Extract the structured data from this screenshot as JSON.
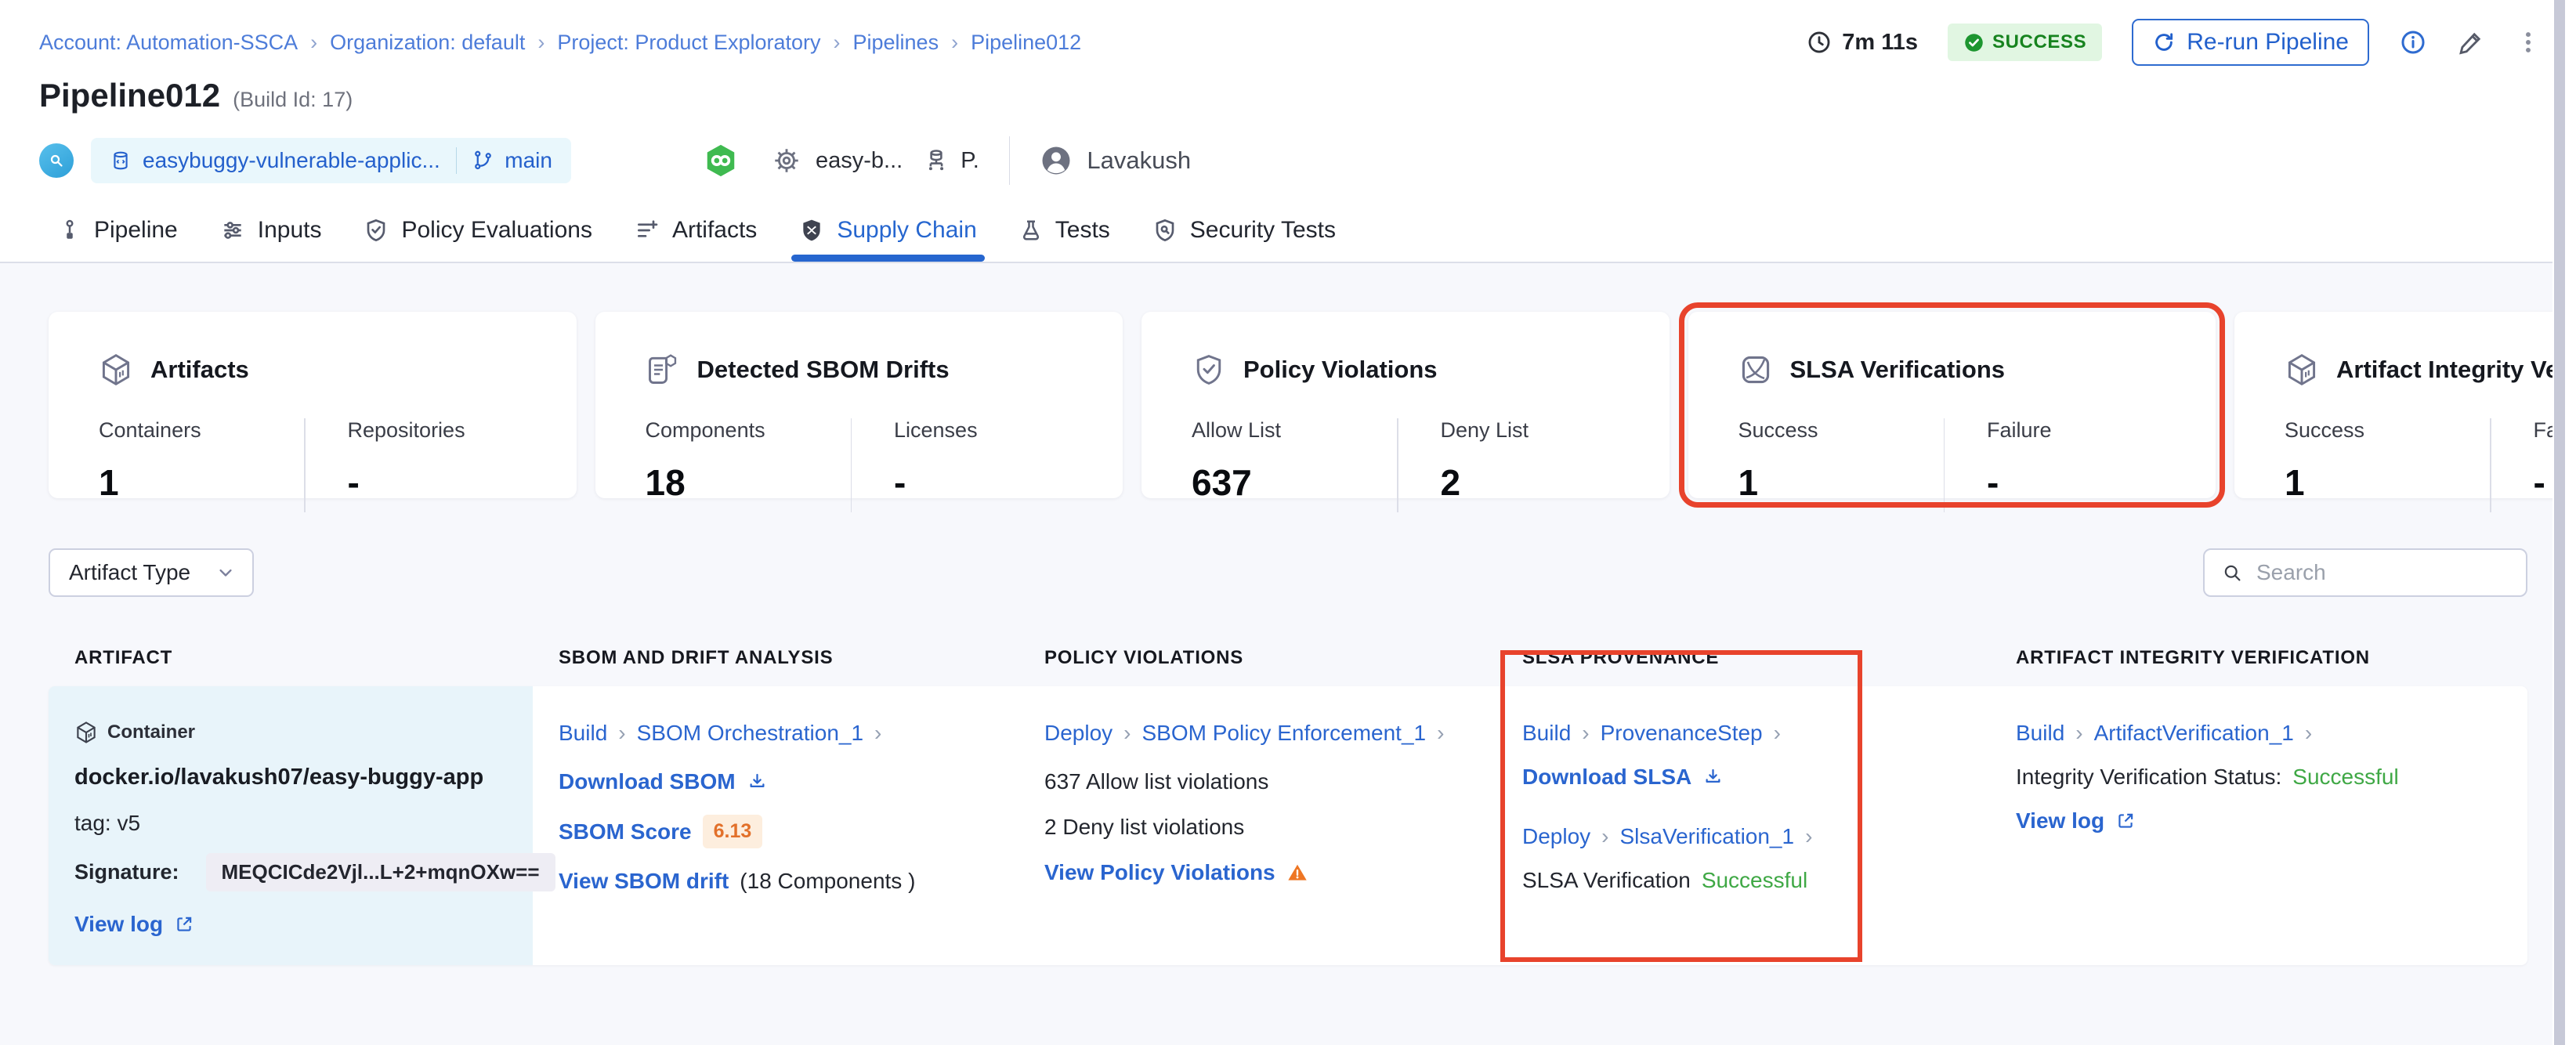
{
  "breadcrumb": [
    "Account: Automation-SSCA",
    "Organization: default",
    "Project: Product Exploratory",
    "Pipelines",
    "Pipeline012"
  ],
  "topbar": {
    "duration": "7m 11s",
    "status_badge": "SUCCESS",
    "rerun_button": "Re-run Pipeline"
  },
  "pipeline": {
    "title": "Pipeline012",
    "build_id": "(Build Id: 17)",
    "repo_name": "easybuggy-vulnerable-applic...",
    "branch": "main",
    "linked_pipeline": "easy-b...",
    "trigger_initial": "P.",
    "user_name": "Lavakush"
  },
  "tabs": [
    {
      "label": "Pipeline"
    },
    {
      "label": "Inputs"
    },
    {
      "label": "Policy Evaluations"
    },
    {
      "label": "Artifacts"
    },
    {
      "label": "Supply Chain",
      "active": true
    },
    {
      "label": "Tests"
    },
    {
      "label": "Security Tests"
    }
  ],
  "cards": [
    {
      "title": "Artifacts",
      "stats": [
        {
          "label": "Containers",
          "value": "1"
        },
        {
          "label": "Repositories",
          "value": "-"
        }
      ]
    },
    {
      "title": "Detected SBOM Drifts",
      "stats": [
        {
          "label": "Components",
          "value": "18"
        },
        {
          "label": "Licenses",
          "value": "-"
        }
      ]
    },
    {
      "title": "Policy Violations",
      "stats": [
        {
          "label": "Allow List",
          "value": "637"
        },
        {
          "label": "Deny List",
          "value": "2"
        }
      ]
    },
    {
      "title": "SLSA Verifications",
      "highlighted": true,
      "stats": [
        {
          "label": "Success",
          "value": "1"
        },
        {
          "label": "Failure",
          "value": "-"
        }
      ]
    },
    {
      "title": "Artifact Integrity Verification",
      "stats": [
        {
          "label": "Success",
          "value": "1"
        },
        {
          "label": "Failure",
          "value": "-"
        }
      ]
    }
  ],
  "filters": {
    "artifact_type": "Artifact Type",
    "search_placeholder": "Search"
  },
  "table": {
    "headers": [
      "ARTIFACT",
      "SBOM AND DRIFT ANALYSIS",
      "POLICY VIOLATIONS",
      "SLSA PROVENANCE",
      "ARTIFACT INTEGRITY VERIFICATION"
    ],
    "row": {
      "artifact": {
        "type": "Container",
        "image": "docker.io/lavakush07/easy-buggy-app",
        "tag": "tag: v5",
        "signature_label": "Signature:",
        "signature": "MEQCICde2Vjl...L+2+mqnOXw==",
        "view_log": "View log"
      },
      "sbom": {
        "stage": "Build",
        "step": "SBOM Orchestration_1",
        "download": "Download SBOM",
        "score_label": "SBOM Score",
        "score": "6.13",
        "drift_link": "View SBOM drift",
        "drift_suffix": "(18 Components )"
      },
      "policy": {
        "stage": "Deploy",
        "step": "SBOM Policy Enforcement_1",
        "allow": "637 Allow list violations",
        "deny": "2 Deny list violations",
        "view": "View Policy Violations"
      },
      "slsa": {
        "stage1": "Build",
        "step1": "ProvenanceStep",
        "download": "Download SLSA",
        "stage2": "Deploy",
        "step2": "SlsaVerification_1",
        "status_label": "SLSA Verification",
        "status_value": "Successful"
      },
      "integrity": {
        "stage": "Build",
        "step": "ArtifactVerification_1",
        "status_label": "Integrity Verification Status:",
        "status_value": "Successful",
        "view_log": "View log"
      }
    }
  },
  "colors": {
    "accent_blue": "#2a65cf",
    "breadcrumb_blue": "#4d7cd9",
    "success_green": "#3fa845",
    "badge_green_bg": "#e1f6e2",
    "badge_green_text": "#17831f",
    "highlight_red": "#e8432c",
    "score_orange": "#e2702a",
    "score_orange_bg": "#fdeede",
    "warning_orange": "#ee7624"
  }
}
